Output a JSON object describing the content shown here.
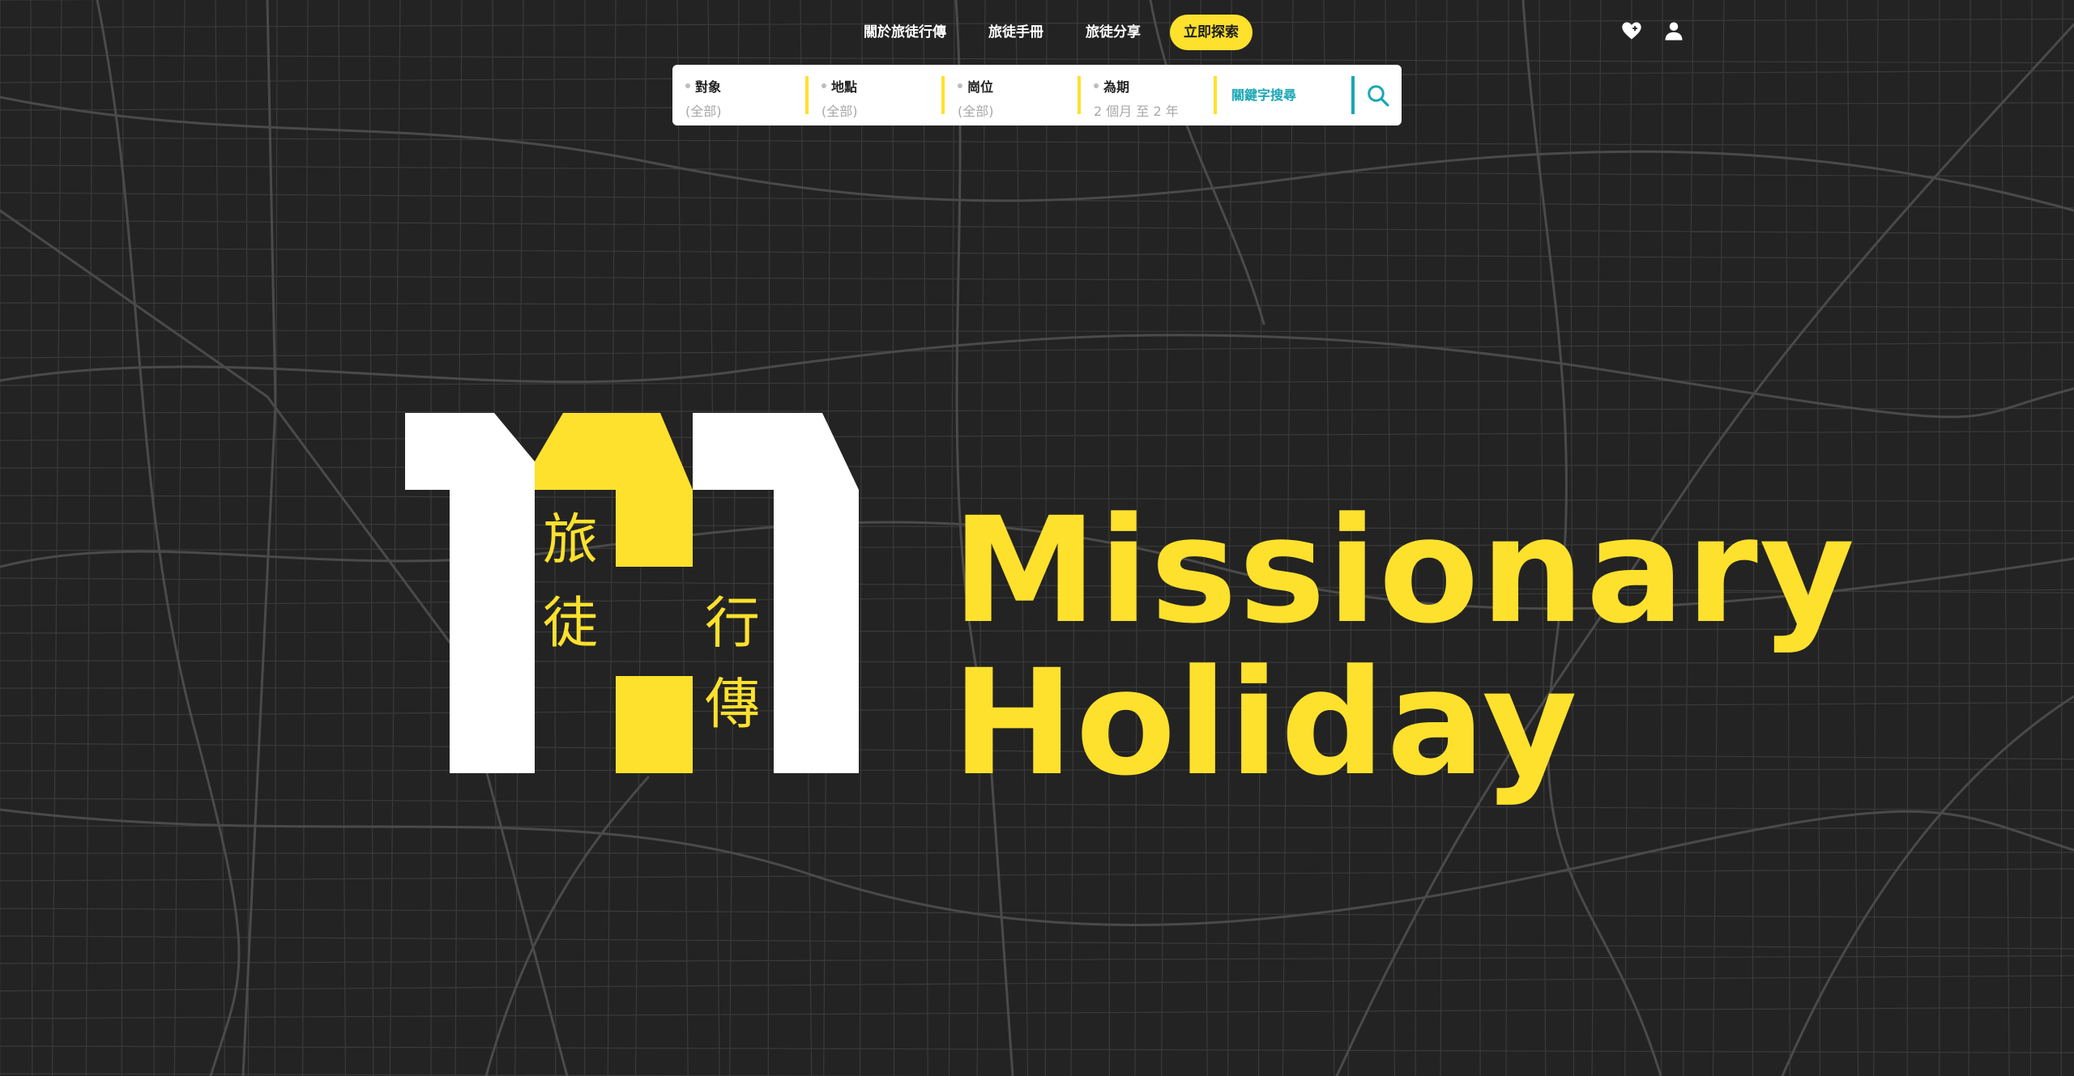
{
  "nav": {
    "items": [
      "關於旅徒行傳",
      "旅徒手冊",
      "旅徒分享"
    ],
    "cta": "立即探索"
  },
  "icons": {
    "favorites": "heart-icon",
    "account": "user-icon",
    "search": "search-icon"
  },
  "search": {
    "fields": [
      {
        "label": "對象",
        "value": "(全部)"
      },
      {
        "label": "地點",
        "value": "(全部)"
      },
      {
        "label": "崗位",
        "value": "(全部)"
      },
      {
        "label": "為期",
        "value": "2 個月 至 2 年"
      }
    ],
    "keyword_placeholder": "關鍵字搜尋"
  },
  "logo": {
    "chars": [
      "旅",
      "徒",
      "行",
      "傳"
    ]
  },
  "brand": {
    "line1": "Missionary",
    "line2": "Holiday"
  },
  "colors": {
    "accent": "#fde12d",
    "teal": "#1aa7b5",
    "background": "#232323",
    "logo_white": "#ffffff"
  }
}
